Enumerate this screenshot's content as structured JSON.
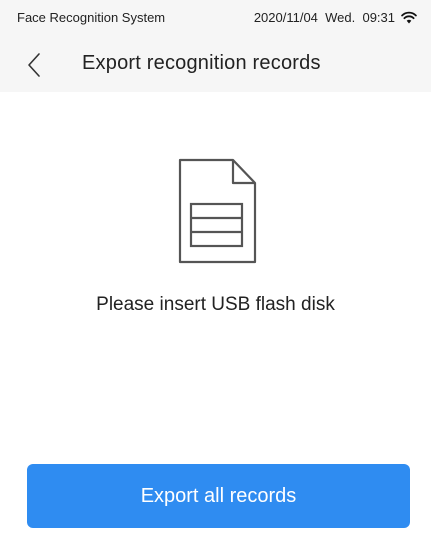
{
  "status_bar": {
    "app_name": "Face Recognition System",
    "datetime": "2020/11/04  Wed.  09:31",
    "wifi_icon": "wifi-icon"
  },
  "header": {
    "back_icon": "chevron-left-icon",
    "title": "Export recognition records"
  },
  "main": {
    "file_icon": "document-icon",
    "message": "Please insert USB flash disk",
    "export_button_label": "Export all records"
  },
  "colors": {
    "accent": "#2f8cf1",
    "background": "#ffffff",
    "bar": "#f6f6f6",
    "icon_stroke": "#555555"
  }
}
